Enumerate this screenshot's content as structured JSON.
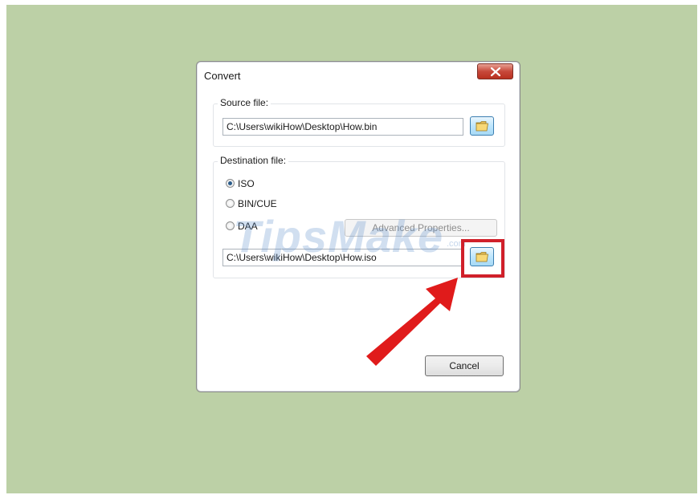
{
  "dialog": {
    "title": "Convert",
    "close_icon": "close-icon"
  },
  "source": {
    "group_label": "Source file:",
    "path": "C:\\Users\\wikiHow\\Desktop\\How.bin",
    "browse_icon": "folder-icon"
  },
  "destination": {
    "group_label": "Destination file:",
    "formats": [
      {
        "label": "ISO",
        "selected": true
      },
      {
        "label": "BIN/CUE",
        "selected": false
      },
      {
        "label": "DAA",
        "selected": false
      }
    ],
    "advanced_label": "Advanced Properties...",
    "path": "C:\\Users\\wikiHow\\Desktop\\How.iso",
    "browse_icon": "folder-icon"
  },
  "buttons": {
    "cancel_label": "Cancel"
  },
  "annotation": {
    "highlight_color": "#d0202a",
    "arrow_color": "#e01b1b"
  },
  "watermark": {
    "text": "TipsMake",
    "suffix": ".com"
  },
  "colors": {
    "background": "#bcd0a6",
    "close_button": "#c7483a",
    "browse_button": "#bee6fd"
  }
}
